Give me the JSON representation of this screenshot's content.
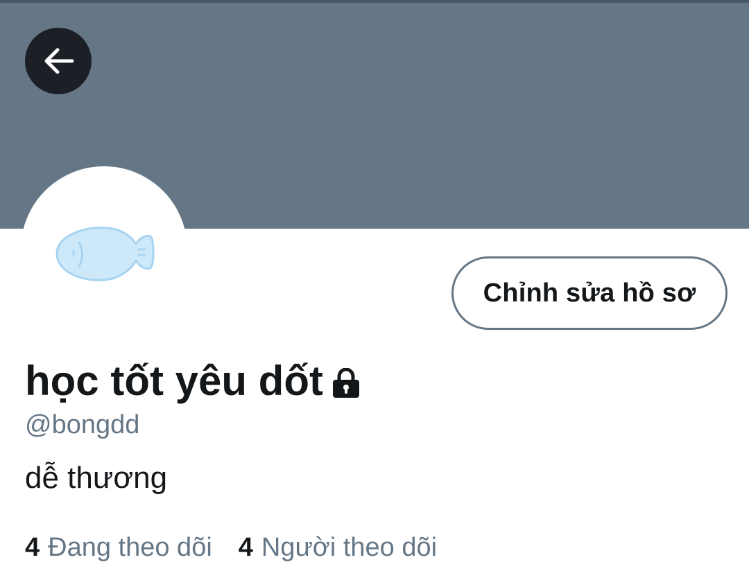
{
  "profile": {
    "display_name": "học tốt yêu dốt",
    "handle": "@bongdd",
    "bio": "dễ thương",
    "protected_icon": "lock-icon",
    "avatar_icon": "fish-icon"
  },
  "actions": {
    "back_icon": "arrow-left-icon",
    "edit_profile_label": "Chỉnh sửa hồ sơ"
  },
  "stats": {
    "following_count": "4",
    "following_label": "Đang theo dõi",
    "followers_count": "4",
    "followers_label": "Người theo dõi"
  },
  "colors": {
    "banner": "#657786",
    "back_button": "#1c2026",
    "text_primary": "#14171a",
    "text_secondary": "#657786",
    "avatar_fish": "#cde8f8",
    "avatar_fish_outline": "#a6d4f2"
  }
}
